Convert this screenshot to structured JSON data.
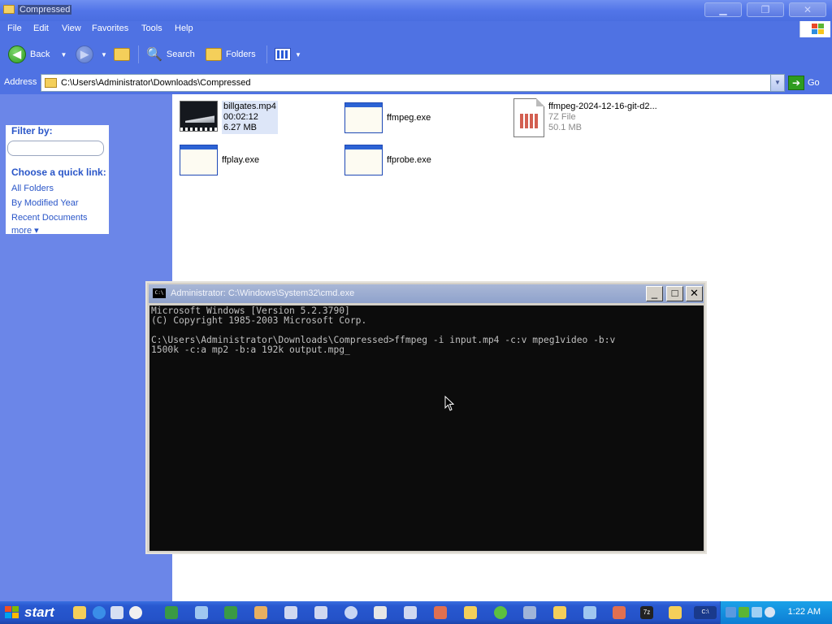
{
  "window": {
    "title": "Compressed"
  },
  "menu": [
    "File",
    "Edit",
    "View",
    "Favorites",
    "Tools",
    "Help"
  ],
  "toolbar": {
    "back": "Back",
    "search": "Search",
    "folders": "Folders"
  },
  "address": {
    "label": "Address",
    "path": "C:\\Users\\Administrator\\Downloads\\Compressed",
    "go": "Go"
  },
  "leftpane": {
    "filter_label": "Filter by:",
    "quick_link_title": "Choose a quick link:",
    "links": [
      "All Folders",
      "By Modified Year",
      "Recent Documents",
      "more ▾"
    ]
  },
  "files": [
    {
      "name": "billgates.mp4",
      "line2": "00:02:12",
      "line3": "6.27 MB",
      "icon": "video-icon"
    },
    {
      "name": "ffmpeg.exe",
      "icon": "exe-icon"
    },
    {
      "name": "ffmpeg-2024-12-16-git-d2...",
      "line2": "7Z File",
      "line3": "50.1 MB",
      "icon": "7z-archive-icon"
    },
    {
      "name": "ffplay.exe",
      "icon": "exe-icon"
    },
    {
      "name": "ffprobe.exe",
      "icon": "exe-icon"
    }
  ],
  "cmd": {
    "title": "Administrator: C:\\Windows\\System32\\cmd.exe",
    "lines": [
      "Microsoft Windows [Version 5.2.3790]",
      "(C) Copyright 1985-2003 Microsoft Corp.",
      "",
      "C:\\Users\\Administrator\\Downloads\\Compressed>ffmpeg -i input.mp4 -c:v mpeg1video -b:v",
      "1500k -c:a mp2 -b:a 192k output.mpg_"
    ]
  },
  "taskbar": {
    "start": "start",
    "clock": "1:22 AM"
  },
  "colors": {
    "xp_blue": "#4f72e3",
    "pane_blue": "#6b86e8",
    "console_bg": "#0c0c0c",
    "console_fg": "#c0c0c0"
  }
}
